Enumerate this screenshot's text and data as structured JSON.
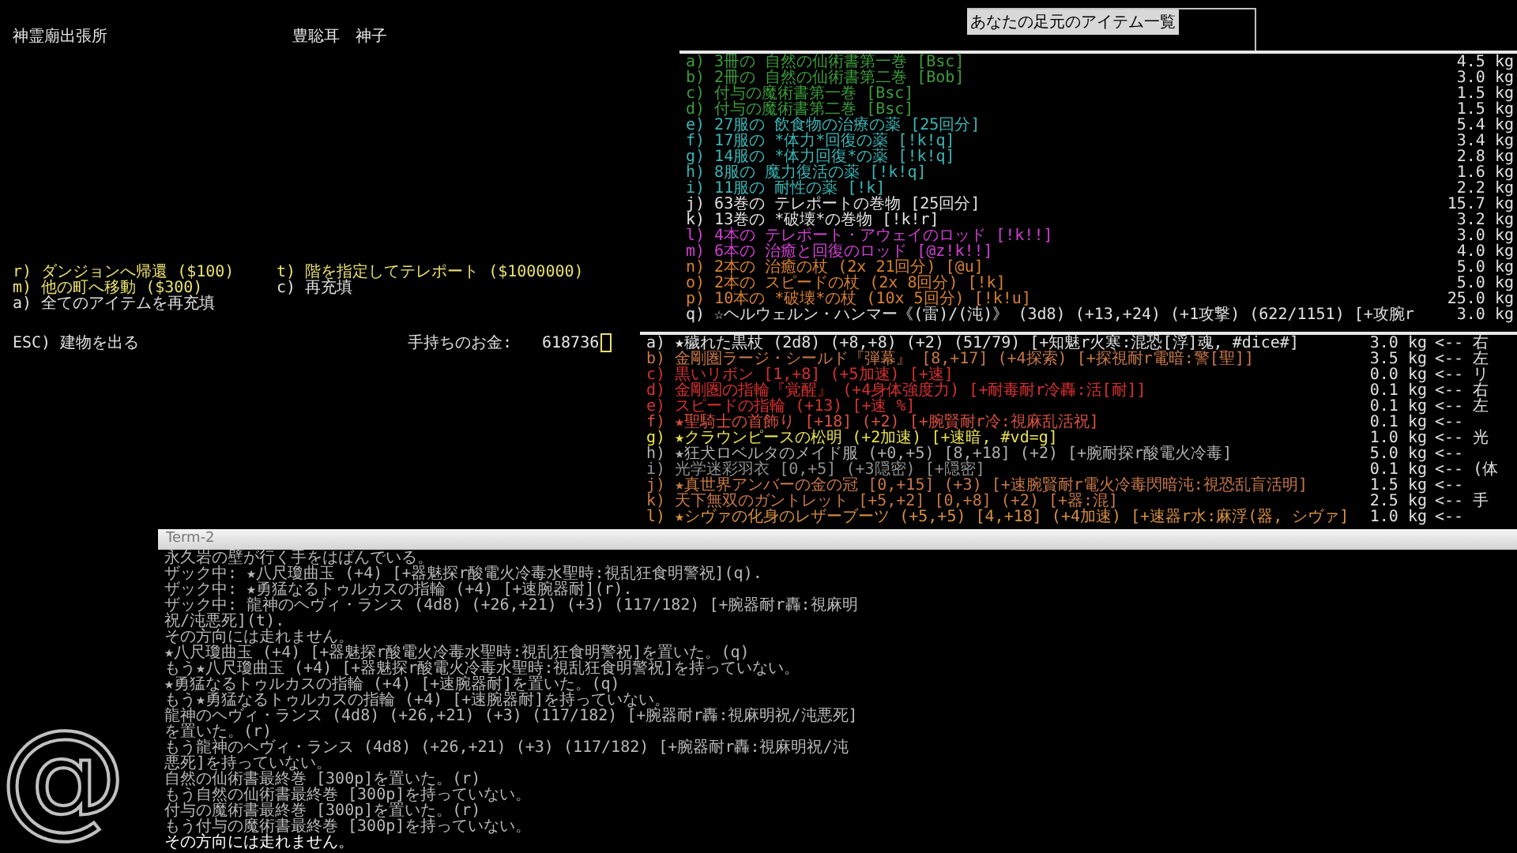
{
  "shop": {
    "name": "神霊廟出張所",
    "owner": "豊聡耳　神子",
    "commands": [
      {
        "label": "r) ダンジョンへ帰還 ($100)",
        "color": "#e8e070"
      },
      {
        "label": "t) 階を指定してテレポート ($1000000)",
        "color": "#e8e070"
      },
      {
        "label": "m) 他の町へ移動 ($300)",
        "color": "#e8e070"
      },
      {
        "label": "c) 再充填",
        "color": "#e0e0e0"
      },
      {
        "label": "a) 全てのアイテムを再充填",
        "color": "#e0e0e0"
      }
    ],
    "exit": "ESC) 建物を出る",
    "gold_label": "手持ちのお金:",
    "gold": "618736"
  },
  "logo": "@",
  "floor_list": {
    "title": "あなたの足元のアイテム一覧"
  },
  "inventory": [
    {
      "label": "a) 3冊の 自然の仙術書第一巻 [Bsc]",
      "weight": "4.5 kg",
      "color": "#3c9c3c"
    },
    {
      "label": "b) 2冊の 自然の仙術書第二巻 [Bob]",
      "weight": "3.0 kg",
      "color": "#3c9c3c"
    },
    {
      "label": "c) 付与の魔術書第一巻 [Bsc]",
      "weight": "1.5 kg",
      "color": "#3c9c3c"
    },
    {
      "label": "d) 付与の魔術書第二巻 [Bsc]",
      "weight": "1.5 kg",
      "color": "#3c9c3c"
    },
    {
      "label": "e) 27服の 飲食物の治療の薬 [25回分]",
      "weight": "5.4 kg",
      "color": "#3cb4b4"
    },
    {
      "label": "f) 17服の *体力*回復の薬 [!k!q]",
      "weight": "3.4 kg",
      "color": "#3cb4b4"
    },
    {
      "label": "g) 14服の *体力回復*の薬 [!k!q]",
      "weight": "2.8 kg",
      "color": "#3cb4b4"
    },
    {
      "label": "h) 8服の 魔力復活の薬 [!k!q]",
      "weight": "1.6 kg",
      "color": "#3cb4b4"
    },
    {
      "label": "i) 11服の 耐性の薬 [!k]",
      "weight": "2.2 kg",
      "color": "#3cb4b4"
    },
    {
      "label": "j) 63巻の テレポートの巻物 [25回分]",
      "weight": "15.7 kg",
      "color": "#e0e0e0"
    },
    {
      "label": "k) 13巻の *破壊*の巻物 [!k!r]",
      "weight": "3.2 kg",
      "color": "#e0e0e0"
    },
    {
      "label": "l) 4本の テレポート・アウェイのロッド [!k!!]",
      "weight": "3.0 kg",
      "color": "#d040d0"
    },
    {
      "label": "m) 6本の 治癒と回復のロッド [@z!k!!]",
      "weight": "4.0 kg",
      "color": "#d040d0"
    },
    {
      "label": "n) 2本の 治癒の杖 (2x 21回分) [@u]",
      "weight": "5.0 kg",
      "color": "#d88030"
    },
    {
      "label": "o) 2本の スピードの杖 (2x 8回分) [!k]",
      "weight": "5.0 kg",
      "color": "#d88030"
    },
    {
      "label": "p) 10本の *破壊*の杖 (10x 5回分) [!k!u]",
      "weight": "25.0 kg",
      "color": "#d88030"
    },
    {
      "label": "q) ☆ヘルウェルン・ハンマー《(雷)/(沌)》 (3d8) (+13,+24) (+1攻撃) (622/1151) [+攻腕r",
      "weight": "3.0 kg",
      "color": "#e0e0e0"
    }
  ],
  "equipment": [
    {
      "label": "a) ★穢れた黒杖 (2d8) (+8,+8) (+2) (51/79) [+知魅r火寒:混恐[浮]魂, #dice#]",
      "weight": "3.0 kg",
      "slot": "<-- 右",
      "color": "#e0e0e0"
    },
    {
      "label": "b) 金剛圏ラージ・シールド『弾幕』 [8,+17] (+4探索) [+探視耐r電暗:警[聖]]",
      "weight": "3.5 kg",
      "slot": "<-- 左",
      "color": "#c87848"
    },
    {
      "label": "c) 黒いリボン [1,+8] (+5加速) [+速]",
      "weight": "0.0 kg",
      "slot": "<-- リ",
      "color": "#d83030"
    },
    {
      "label": "d) 金剛圏の指輪『覚醒』 (+4身体強度力) [+耐毒耐r冷轟:活[耐]]",
      "weight": "0.1 kg",
      "slot": "<-- 右",
      "color": "#d83030"
    },
    {
      "label": "e) スピードの指輪 (+13) [+速 %]",
      "weight": "0.1 kg",
      "slot": "<-- 左",
      "color": "#d83030"
    },
    {
      "label": "f) ★聖騎士の首飾り [+18] (+2) [+腕賢耐r冷:視麻乱活祝]",
      "weight": "0.1 kg",
      "slot": "<--",
      "color": "#d85040"
    },
    {
      "label": "g) ★クラウンピースの松明 (+2加速) [+速暗, #vd=g]",
      "weight": "1.0 kg",
      "slot": "<-- 光",
      "color": "#e8e050"
    },
    {
      "label": "h) ★狂犬ロベルタのメイド服 (+0,+5) [8,+18] (+2) [+腕耐探r酸電火冷毒]",
      "weight": "5.0 kg",
      "slot": "<--",
      "color": "#b0b0b0"
    },
    {
      "label": "i) 光学迷彩羽衣 [0,+5] (+3隠密) [+隠密]",
      "weight": "0.1 kg",
      "slot": "<-- (体",
      "color": "#909090"
    },
    {
      "label": "j) ★真世界アンバーの金の冠 [0,+15] (+3) [+速腕賢耐r電火冷毒閃暗沌:視恐乱盲活明]",
      "weight": "1.5 kg",
      "slot": "<--",
      "color": "#c87848"
    },
    {
      "label": "k) 天下無双のガントレット [+5,+2] [0,+8] (+2) [+器:混]",
      "weight": "2.5 kg",
      "slot": "<-- 手",
      "color": "#c87848"
    },
    {
      "label": "l) ★シヴァの化身のレザーブーツ (+5,+5) [4,+18] (+4加速) [+速器r水:麻浮(器, シヴァ]",
      "weight": "1.0 kg",
      "slot": "<--",
      "color": "#d89040"
    }
  ],
  "term2": {
    "title": "Term-2",
    "lines": [
      {
        "text": "永久岩の壁が行く手をはばんでいる。",
        "color": "#b8b8b8"
      },
      {
        "text": "ザック中: ★八尺瓊曲玉 (+4) [+器魅探r酸電火冷毒水聖時:視乱狂食明警祝](q).",
        "color": "#b8b8b8"
      },
      {
        "text": "ザック中: ★勇猛なるトゥルカスの指輪 (+4) [+速腕器耐](r).",
        "color": "#b8b8b8"
      },
      {
        "text": "ザック中: 龍神のヘヴィ・ランス (4d8) (+26,+21) (+3) (117/182) [+腕器耐r轟:視麻明",
        "color": "#b8b8b8"
      },
      {
        "text": "祝/沌悪死](t).",
        "color": "#b8b8b8"
      },
      {
        "text": "その方向には走れません。",
        "color": "#b8b8b8"
      },
      {
        "text": "★八尺瓊曲玉 (+4) [+器魅探r酸電火冷毒水聖時:視乱狂食明警祝]を置いた。(q)",
        "color": "#b8b8b8"
      },
      {
        "text": "もう★八尺瓊曲玉 (+4) [+器魅探r酸電火冷毒水聖時:視乱狂食明警祝]を持っていない。",
        "color": "#b8b8b8"
      },
      {
        "text": "★勇猛なるトゥルカスの指輪 (+4) [+速腕器耐]を置いた。(q)",
        "color": "#b8b8b8"
      },
      {
        "text": "もう★勇猛なるトゥルカスの指輪 (+4) [+速腕器耐]を持っていない。",
        "color": "#b8b8b8"
      },
      {
        "text": "龍神のヘヴィ・ランス (4d8) (+26,+21) (+3) (117/182) [+腕器耐r轟:視麻明祝/沌悪死]",
        "color": "#b8b8b8"
      },
      {
        "text": "を置いた。(r)",
        "color": "#b8b8b8"
      },
      {
        "text": "もう龍神のヘヴィ・ランス (4d8) (+26,+21) (+3) (117/182) [+腕器耐r轟:視麻明祝/沌",
        "color": "#b8b8b8"
      },
      {
        "text": "悪死]を持っていない。",
        "color": "#b8b8b8"
      },
      {
        "text": "自然の仙術書最終巻 [300p]を置いた。(r)",
        "color": "#b8b8b8"
      },
      {
        "text": "もう自然の仙術書最終巻 [300p]を持っていない。",
        "color": "#b8b8b8"
      },
      {
        "text": "付与の魔術書最終巻 [300p]を置いた。(r)",
        "color": "#b8b8b8"
      },
      {
        "text": "もう付与の魔術書最終巻 [300p]を持っていない。",
        "color": "#b8b8b8"
      },
      {
        "text": "その方向には走れません。",
        "color": "#ffffff"
      }
    ]
  }
}
